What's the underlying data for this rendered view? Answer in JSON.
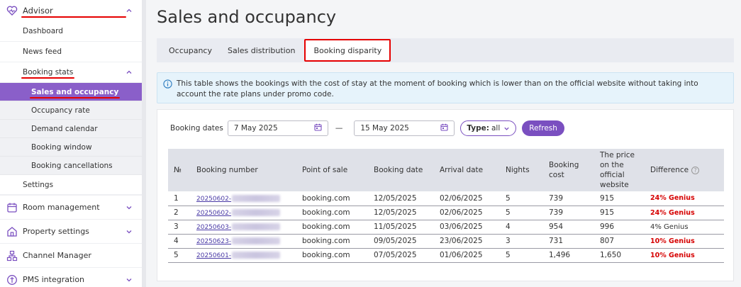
{
  "sidebar": {
    "advisor": "Advisor",
    "dashboard": "Dashboard",
    "news_feed": "News feed",
    "booking_stats": "Booking stats",
    "sub": [
      "Sales and occupancy",
      "Occupancy rate",
      "Demand calendar",
      "Booking window",
      "Booking cancellations"
    ],
    "settings": "Settings",
    "room_management": "Room management",
    "property_settings": "Property settings",
    "channel_manager": "Channel Manager",
    "pms_integration": "PMS integration"
  },
  "page": {
    "title": "Sales and occupancy"
  },
  "tabs": [
    "Occupancy",
    "Sales distribution",
    "Booking disparity"
  ],
  "info": "This table shows the bookings with the cost of stay at the moment of booking which is lower than on the official website without taking into account the rate plans under promo code.",
  "filters": {
    "label": "Booking dates",
    "from": "7 May 2025",
    "dash": "—",
    "to": "15 May 2025",
    "type_label": "Type:",
    "type_value": "all",
    "refresh": "Refresh"
  },
  "table": {
    "headers": [
      "№",
      "Booking number",
      "Point of sale",
      "Booking date",
      "Arrival date",
      "Nights",
      "Booking cost",
      "The price on the official website",
      "Difference"
    ],
    "rows": [
      {
        "n": "1",
        "booking": "20250602-",
        "pos": "booking.com",
        "bdate": "12/05/2025",
        "adate": "02/06/2025",
        "nights": "5",
        "cost": "739",
        "official": "915",
        "diff": "24%  Genius",
        "red": true
      },
      {
        "n": "2",
        "booking": "20250602-",
        "pos": "booking.com",
        "bdate": "12/05/2025",
        "adate": "02/06/2025",
        "nights": "5",
        "cost": "739",
        "official": "915",
        "diff": "24%  Genius",
        "red": true
      },
      {
        "n": "3",
        "booking": "20250603-",
        "pos": "booking.com",
        "bdate": "11/05/2025",
        "adate": "03/06/2025",
        "nights": "4",
        "cost": "954",
        "official": "996",
        "diff": "4%  Genius",
        "red": false
      },
      {
        "n": "4",
        "booking": "20250623-",
        "pos": "booking.com",
        "bdate": "09/05/2025",
        "adate": "23/06/2025",
        "nights": "3",
        "cost": "731",
        "official": "807",
        "diff": "10%  Genius",
        "red": true
      },
      {
        "n": "5",
        "booking": "20250601-",
        "pos": "booking.com",
        "bdate": "07/05/2025",
        "adate": "01/06/2025",
        "nights": "5",
        "cost": "1,496",
        "official": "1,650",
        "diff": "10%  Genius",
        "red": true
      }
    ]
  },
  "colors": {
    "accent": "#7a4fc0",
    "active_nav": "#8a5fc9",
    "highlight": "#e60000",
    "diff_red": "#d60000"
  }
}
